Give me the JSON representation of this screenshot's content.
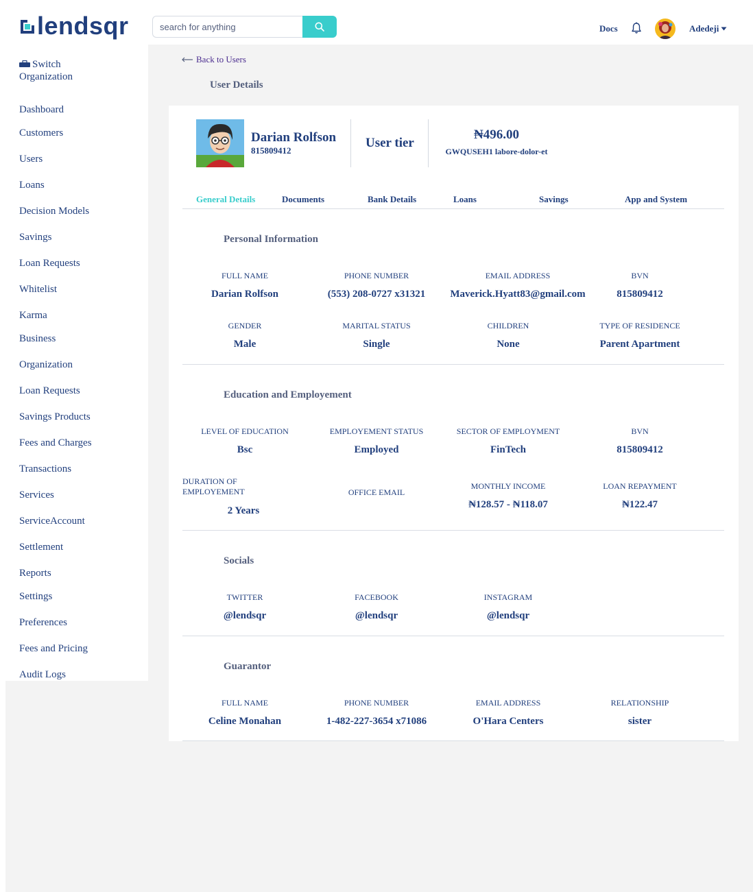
{
  "header": {
    "logo_text": "lendsqr",
    "search_placeholder": "search for anything",
    "docs_label": "Docs",
    "user_name": "Adedeji"
  },
  "sidebar": {
    "switch_org": "Switch Organization",
    "items": [
      "Dashboard",
      "Customers",
      "Users",
      "Loans",
      "Decision Models",
      "Savings",
      "Loan Requests",
      "Whitelist",
      "Karma",
      "Business",
      "Organization",
      "Loan Requests",
      "Savings Products",
      "Fees and Charges",
      "Transactions",
      "Services",
      "ServiceAccount",
      "Settlement",
      "Reports",
      "Settings",
      "Preferences",
      "Fees and Pricing",
      "Audit Logs"
    ]
  },
  "page": {
    "back_label": "Back to Users",
    "title": "User Details"
  },
  "profile": {
    "name": "Darian Rolfson",
    "id": "815809412",
    "tier_label": "User tier",
    "balance": "₦496.00",
    "bank_info": "GWQUSEH1 labore-dolor-et"
  },
  "tabs": [
    "General Details",
    "Documents",
    "Bank Details",
    "Loans",
    "Savings",
    "App and System"
  ],
  "personal": {
    "title": "Personal Information",
    "full_name_label": "FULL NAME",
    "full_name": "Darian Rolfson",
    "phone_label": "PHONE NUMBER",
    "phone": "(553) 208-0727 x31321",
    "email_label": "EMAIL ADDRESS",
    "email": "Maverick.Hyatt83@gmail.com",
    "bvn_label": "BVN",
    "bvn": "815809412",
    "gender_label": "GENDER",
    "gender": "Male",
    "marital_label": "MARITAL STATUS",
    "marital": "Single",
    "children_label": "CHILDREN",
    "children": "None",
    "residence_label": "TYPE OF RESIDENCE",
    "residence": "Parent Apartment"
  },
  "education": {
    "title": "Education and Employement",
    "level_label": "LEVEL OF EDUCATION",
    "level": "Bsc",
    "status_label": "EMPLOYEMENT STATUS",
    "status": "Employed",
    "sector_label": "SECTOR OF EMPLOYMENT",
    "sector": "FinTech",
    "bvn_label": "BVN",
    "bvn": "815809412",
    "duration_label": "DURATION OF EMPLOYEMENT",
    "duration": "2 Years",
    "office_email_label": "OFFICE EMAIL",
    "office_email": "",
    "income_label": "MONTHLY INCOME",
    "income": "₦128.57 - ₦118.07",
    "repayment_label": "LOAN REPAYMENT",
    "repayment": "₦122.47"
  },
  "socials": {
    "title": "Socials",
    "twitter_label": "TWITTER",
    "twitter": "@lendsqr",
    "facebook_label": "FACEBOOK",
    "facebook": "@lendsqr",
    "instagram_label": "INSTAGRAM",
    "instagram": "@lendsqr"
  },
  "guarantor": {
    "title": "Guarantor",
    "full_name_label": "FULL NAME",
    "full_name": "Celine Monahan",
    "phone_label": "PHONE NUMBER",
    "phone": "1-482-227-3654 x71086",
    "email_label": "EMAIL ADDRESS",
    "email": "O'Hara Centers",
    "relationship_label": "RELATIONSHIP",
    "relationship": "sister"
  },
  "colors": {
    "primary": "#213f7d",
    "accent": "#39cdcc",
    "muted": "#545f7d",
    "background": "#f3f3f3"
  },
  "icons": [
    "lendsqr-logo-icon",
    "search-icon",
    "bell-icon",
    "briefcase-icon",
    "arrow-left-icon",
    "caret-down-icon",
    "user-avatar-icon"
  ]
}
